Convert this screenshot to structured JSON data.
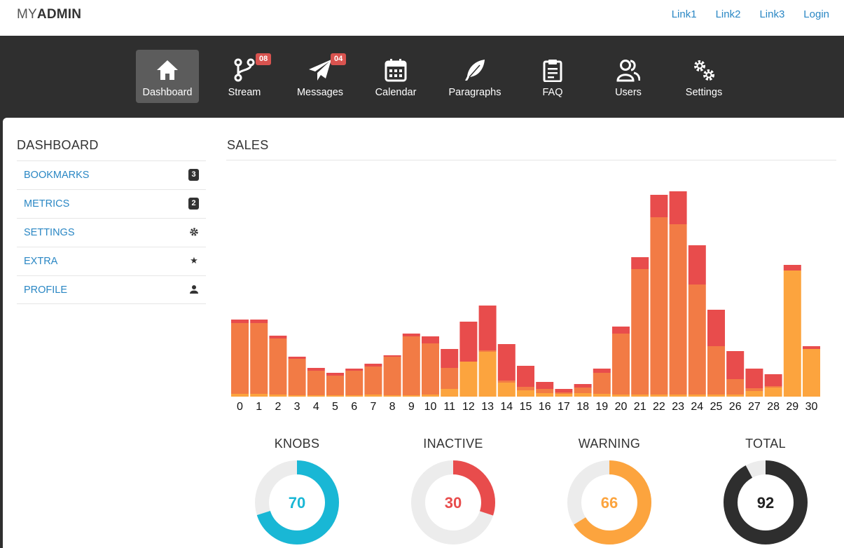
{
  "brand": {
    "light": "MY",
    "bold": "ADMIN"
  },
  "top_links": [
    "Link1",
    "Link2",
    "Link3",
    "Login"
  ],
  "nav": [
    {
      "label": "Dashboard",
      "icon": "home-icon",
      "active": true,
      "badge": ""
    },
    {
      "label": "Stream",
      "icon": "fork-icon",
      "active": false,
      "badge": "08"
    },
    {
      "label": "Messages",
      "icon": "paper-plane-icon",
      "active": false,
      "badge": "04"
    },
    {
      "label": "Calendar",
      "icon": "calendar-icon",
      "active": false,
      "badge": ""
    },
    {
      "label": "Paragraphs",
      "icon": "feather-icon",
      "active": false,
      "badge": ""
    },
    {
      "label": "FAQ",
      "icon": "clipboard-icon",
      "active": false,
      "badge": ""
    },
    {
      "label": "Users",
      "icon": "users-icon",
      "active": false,
      "badge": ""
    },
    {
      "label": "Settings",
      "icon": "gears-icon",
      "active": false,
      "badge": ""
    }
  ],
  "sidebar": {
    "title": "DASHBOARD",
    "items": [
      {
        "label": "BOOKMARKS",
        "count": "3",
        "icon": ""
      },
      {
        "label": "METRICS",
        "count": "2",
        "icon": ""
      },
      {
        "label": "SETTINGS",
        "count": "",
        "icon": "cog-icon"
      },
      {
        "label": "EXTRA",
        "count": "",
        "icon": "star-icon"
      },
      {
        "label": "PROFILE",
        "count": "",
        "icon": "user-icon"
      }
    ]
  },
  "sales": {
    "title": "SALES"
  },
  "chart_data": {
    "type": "bar",
    "stacked": true,
    "categories": [
      "0",
      "1",
      "2",
      "3",
      "4",
      "5",
      "6",
      "7",
      "8",
      "9",
      "10",
      "11",
      "12",
      "13",
      "14",
      "15",
      "16",
      "17",
      "18",
      "19",
      "20",
      "21",
      "22",
      "23",
      "24",
      "25",
      "26",
      "27",
      "28",
      "29",
      "30"
    ],
    "series": [
      {
        "color": "#fca43e",
        "values": [
          4,
          4,
          3,
          2,
          2,
          2,
          2,
          3,
          2,
          2,
          3,
          11,
          50,
          64,
          20,
          9,
          5,
          4,
          5,
          4,
          3,
          3,
          3,
          3,
          3,
          3,
          3,
          8,
          13,
          180,
          68
        ]
      },
      {
        "color": "#f27b45",
        "values": [
          101,
          101,
          80,
          52,
          35,
          28,
          35,
          40,
          55,
          84,
          73,
          30,
          0,
          2,
          3,
          5,
          6,
          2,
          8,
          30,
          87,
          179,
          253,
          243,
          157,
          69,
          22,
          4,
          2,
          0,
          0
        ]
      },
      {
        "color": "#e84c4c",
        "values": [
          5,
          5,
          4,
          3,
          4,
          4,
          3,
          4,
          2,
          4,
          10,
          27,
          57,
          64,
          52,
          30,
          10,
          5,
          5,
          6,
          10,
          17,
          32,
          47,
          56,
          52,
          40,
          28,
          17,
          8,
          4
        ]
      }
    ],
    "ylim": [
      0,
      300
    ]
  },
  "donuts": [
    {
      "title": "KNOBS",
      "value": 70,
      "color": "#19b7d5"
    },
    {
      "title": "INACTIVE",
      "value": 30,
      "color": "#e84c4c"
    },
    {
      "title": "WARNING",
      "value": 66,
      "color": "#fca43e"
    },
    {
      "title": "TOTAL",
      "value": 92,
      "color": "#2e2e2e"
    }
  ]
}
